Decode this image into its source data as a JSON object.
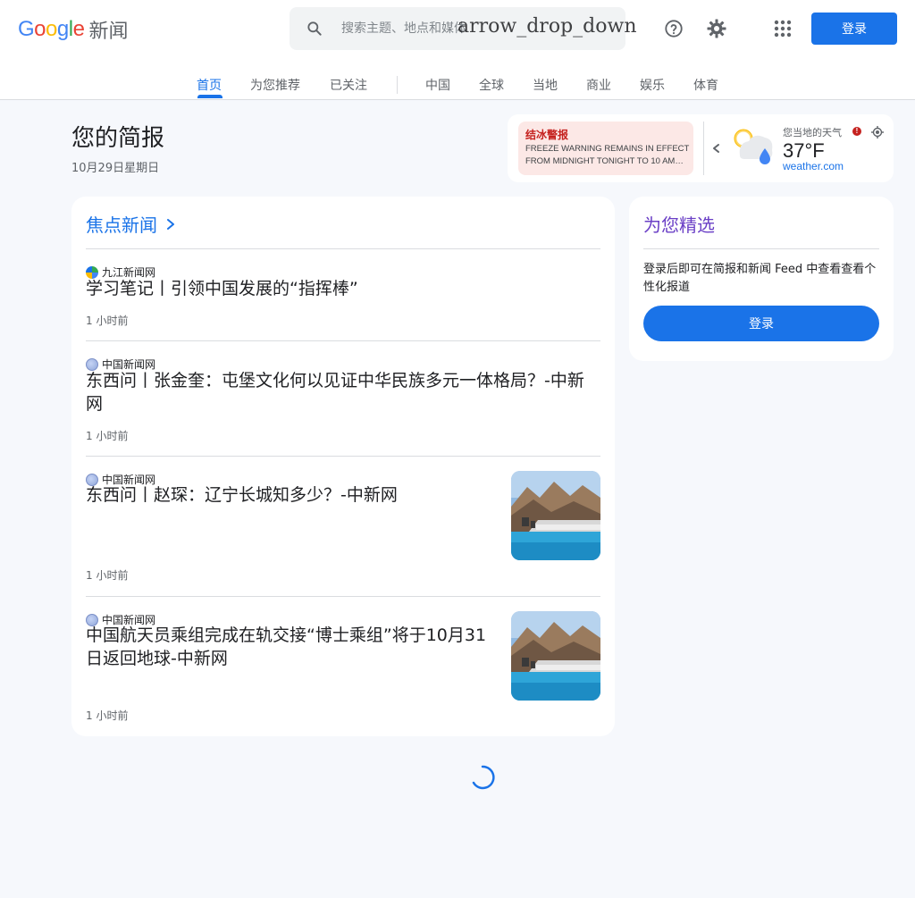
{
  "header": {
    "logo_text": "Google",
    "logo_suffix": "新闻",
    "search_placeholder": "搜索主题、地点和媒体",
    "search_overlay_text": "arrow_drop_down",
    "signin_label": "登录"
  },
  "icons": {
    "search": "search-icon",
    "help": "help-icon",
    "settings": "gear-icon",
    "apps": "apps-grid-icon"
  },
  "tabs": [
    {
      "label": "首页",
      "active": true
    },
    {
      "label": "为您推荐"
    },
    {
      "label": "已关注"
    },
    {
      "label": "中国"
    },
    {
      "label": "全球"
    },
    {
      "label": "当地"
    },
    {
      "label": "商业"
    },
    {
      "label": "娱乐"
    },
    {
      "label": "体育"
    }
  ],
  "briefing": {
    "title": "您的简报",
    "date": "10月29日星期日"
  },
  "weather": {
    "alert_title": "结冰警报",
    "alert_text": "FREEZE WARNING REMAINS IN EFFECT FROM MIDNIGHT TONIGHT TO 10 AM…",
    "label": "您当地的天气",
    "alert_badge": "!",
    "temperature": "37°F",
    "source": "weather.com"
  },
  "top_news": {
    "title": "焦点新闻",
    "articles": [
      {
        "source": "九江新闻网",
        "headline": "学习笔记丨引领中国发展的“指挥棒”",
        "time": "1 小时前"
      },
      {
        "source": "中国新闻网",
        "headline": "东西问丨张金奎：屯堡文化何以见证中华民族多元一体格局？-中新网",
        "time": "1 小时前"
      },
      {
        "source": "中国新闻网",
        "headline": "东西问丨赵琛：辽宁长城知多少？-中新网",
        "time": "1 小时前"
      },
      {
        "source": "中国新闻网",
        "headline": "中国航天员乘组完成在轨交接“博士乘组”将于10月31日返回地球-中新网",
        "time": "1 小时前"
      }
    ]
  },
  "for_you": {
    "title": "为您精选",
    "text": "登录后即可在简报和新闻 Feed 中查看查看个性化报道",
    "button_label": "登录"
  },
  "colors": {
    "accent": "#1a73e8",
    "for_you_title": "#6a3fc6",
    "alert_bg": "#fce8e6",
    "alert_text": "#c5221f"
  }
}
